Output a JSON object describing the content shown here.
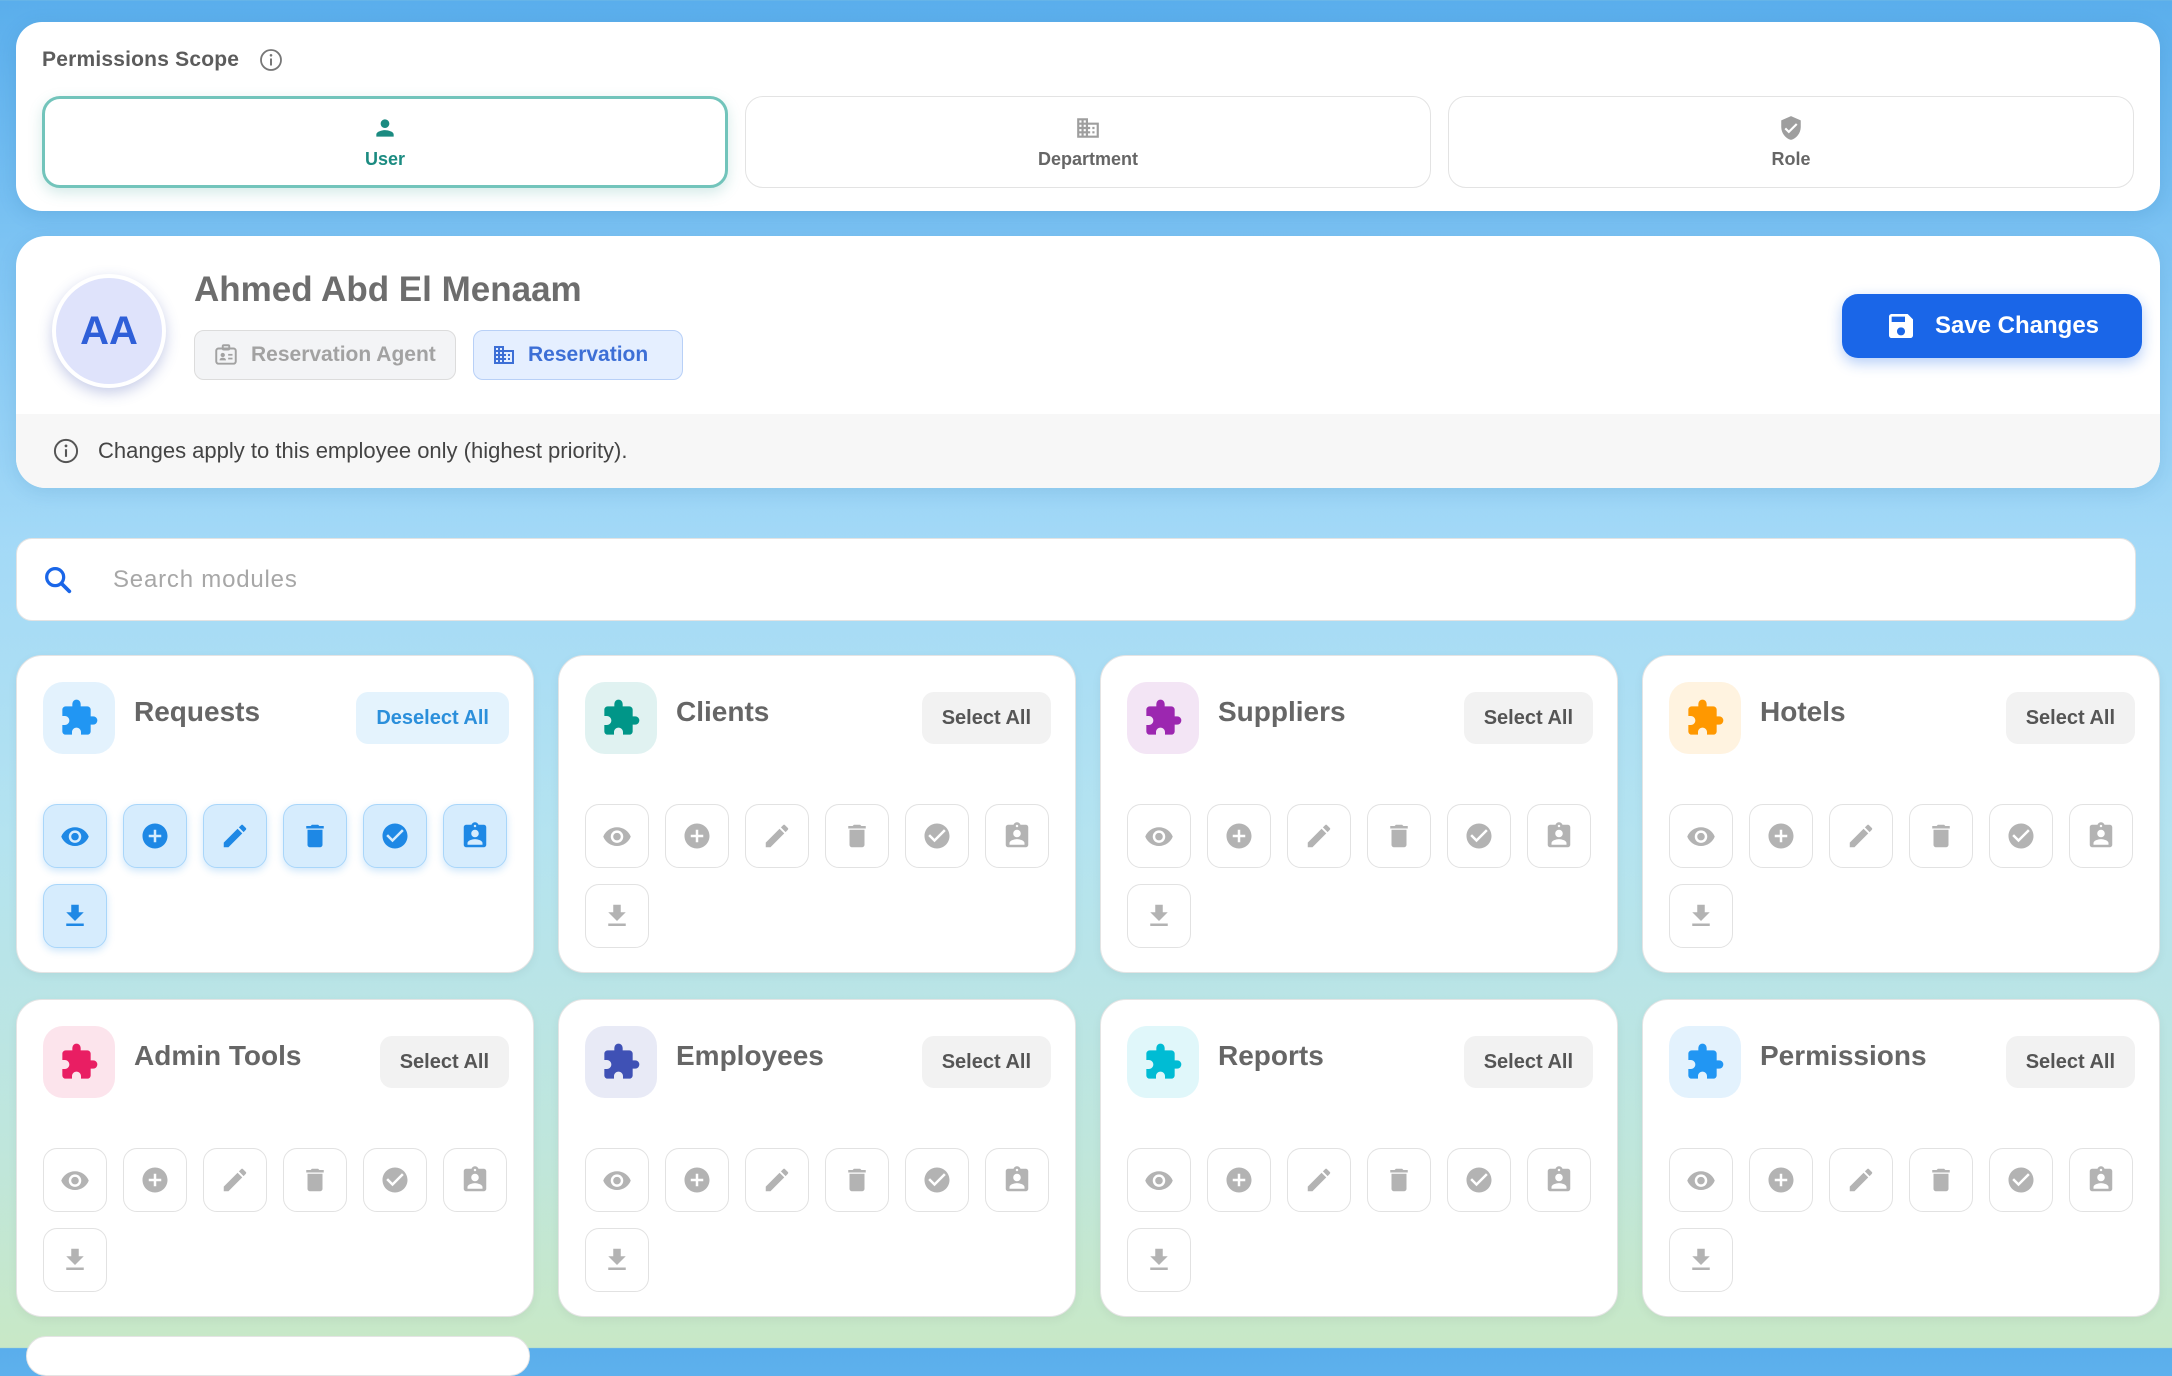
{
  "scope": {
    "title": "Permissions Scope",
    "tabs": [
      {
        "label": "User",
        "icon": "person-icon",
        "active": true
      },
      {
        "label": "Department",
        "icon": "building-icon",
        "active": false
      },
      {
        "label": "Role",
        "icon": "shield-check-icon",
        "active": false
      }
    ]
  },
  "employee": {
    "initials": "AA",
    "name": "Ahmed Abd El Menaam",
    "role": "Reservation Agent",
    "department": "Reservation",
    "save_label": "Save Changes",
    "note": "Changes apply to this employee only (highest priority)."
  },
  "search": {
    "placeholder": "Search modules",
    "value": ""
  },
  "colors": {
    "accent": "#1a66e8",
    "active_tab": "#1b8b81",
    "perm_on": "#1e88e5",
    "perm_off": "#b3b3b3"
  },
  "permission_icons": [
    "eye-icon",
    "add-circle-icon",
    "edit-pencil-icon",
    "trash-icon",
    "check-circle-icon",
    "badge-icon",
    "download-icon"
  ],
  "modules": [
    {
      "name": "Requests",
      "color": "#2196f3",
      "bg": "#e3f2fd",
      "button": "Deselect All",
      "selected": true
    },
    {
      "name": "Clients",
      "color": "#009688",
      "bg": "#e0f2f1",
      "button": "Select All",
      "selected": false
    },
    {
      "name": "Suppliers",
      "color": "#9c27b0",
      "bg": "#f3e5f5",
      "button": "Select All",
      "selected": false
    },
    {
      "name": "Hotels",
      "color": "#ff9800",
      "bg": "#fff3e0",
      "button": "Select All",
      "selected": false
    },
    {
      "name": "Admin Tools",
      "color": "#e91e63",
      "bg": "#fce4ec",
      "button": "Select All",
      "selected": false
    },
    {
      "name": "Employees",
      "color": "#3f51b5",
      "bg": "#e8eaf6",
      "button": "Select All",
      "selected": false
    },
    {
      "name": "Reports",
      "color": "#00bcd4",
      "bg": "#e0f7fa",
      "button": "Select All",
      "selected": false
    },
    {
      "name": "Permissions",
      "color": "#2196f3",
      "bg": "#e3f2fd",
      "button": "Select All",
      "selected": false
    }
  ]
}
